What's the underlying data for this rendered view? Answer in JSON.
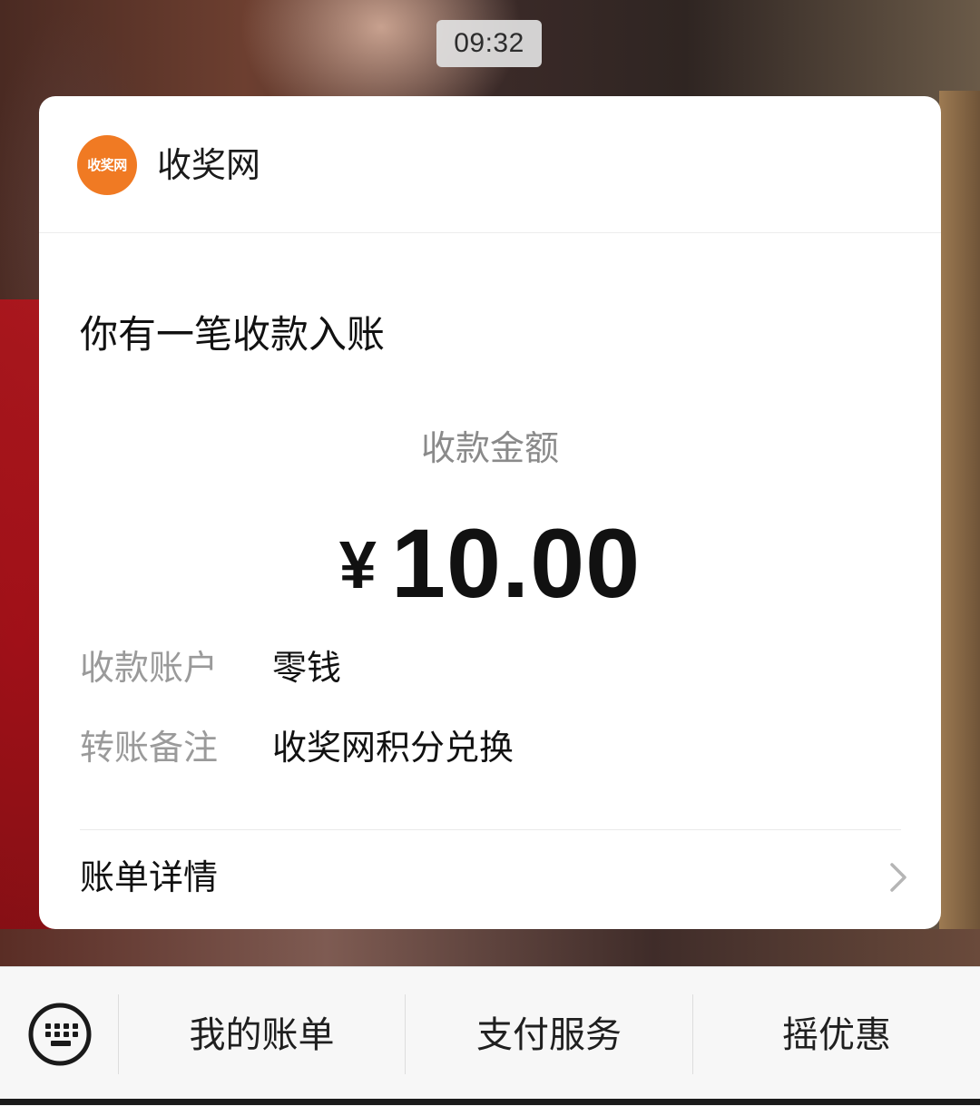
{
  "status": {
    "time": "09:32"
  },
  "card": {
    "brand": {
      "logo_text": "收奖网",
      "name": "收奖网",
      "logo_color": "#f07a23"
    },
    "notice_title": "你有一笔收款入账",
    "amount_label": "收款金额",
    "currency_symbol": "¥",
    "amount": "10.00",
    "details": [
      {
        "label": "收款账户",
        "value": "零钱"
      },
      {
        "label": "转账备注",
        "value": "收奖网积分兑换"
      }
    ],
    "bill_details_label": "账单详情"
  },
  "bottom_bar": {
    "items": [
      {
        "label": "我的账单"
      },
      {
        "label": "支付服务"
      },
      {
        "label": "摇优惠"
      }
    ]
  },
  "icons": {
    "keyboard": "keyboard-icon",
    "chevron": "chevron-right-icon"
  }
}
